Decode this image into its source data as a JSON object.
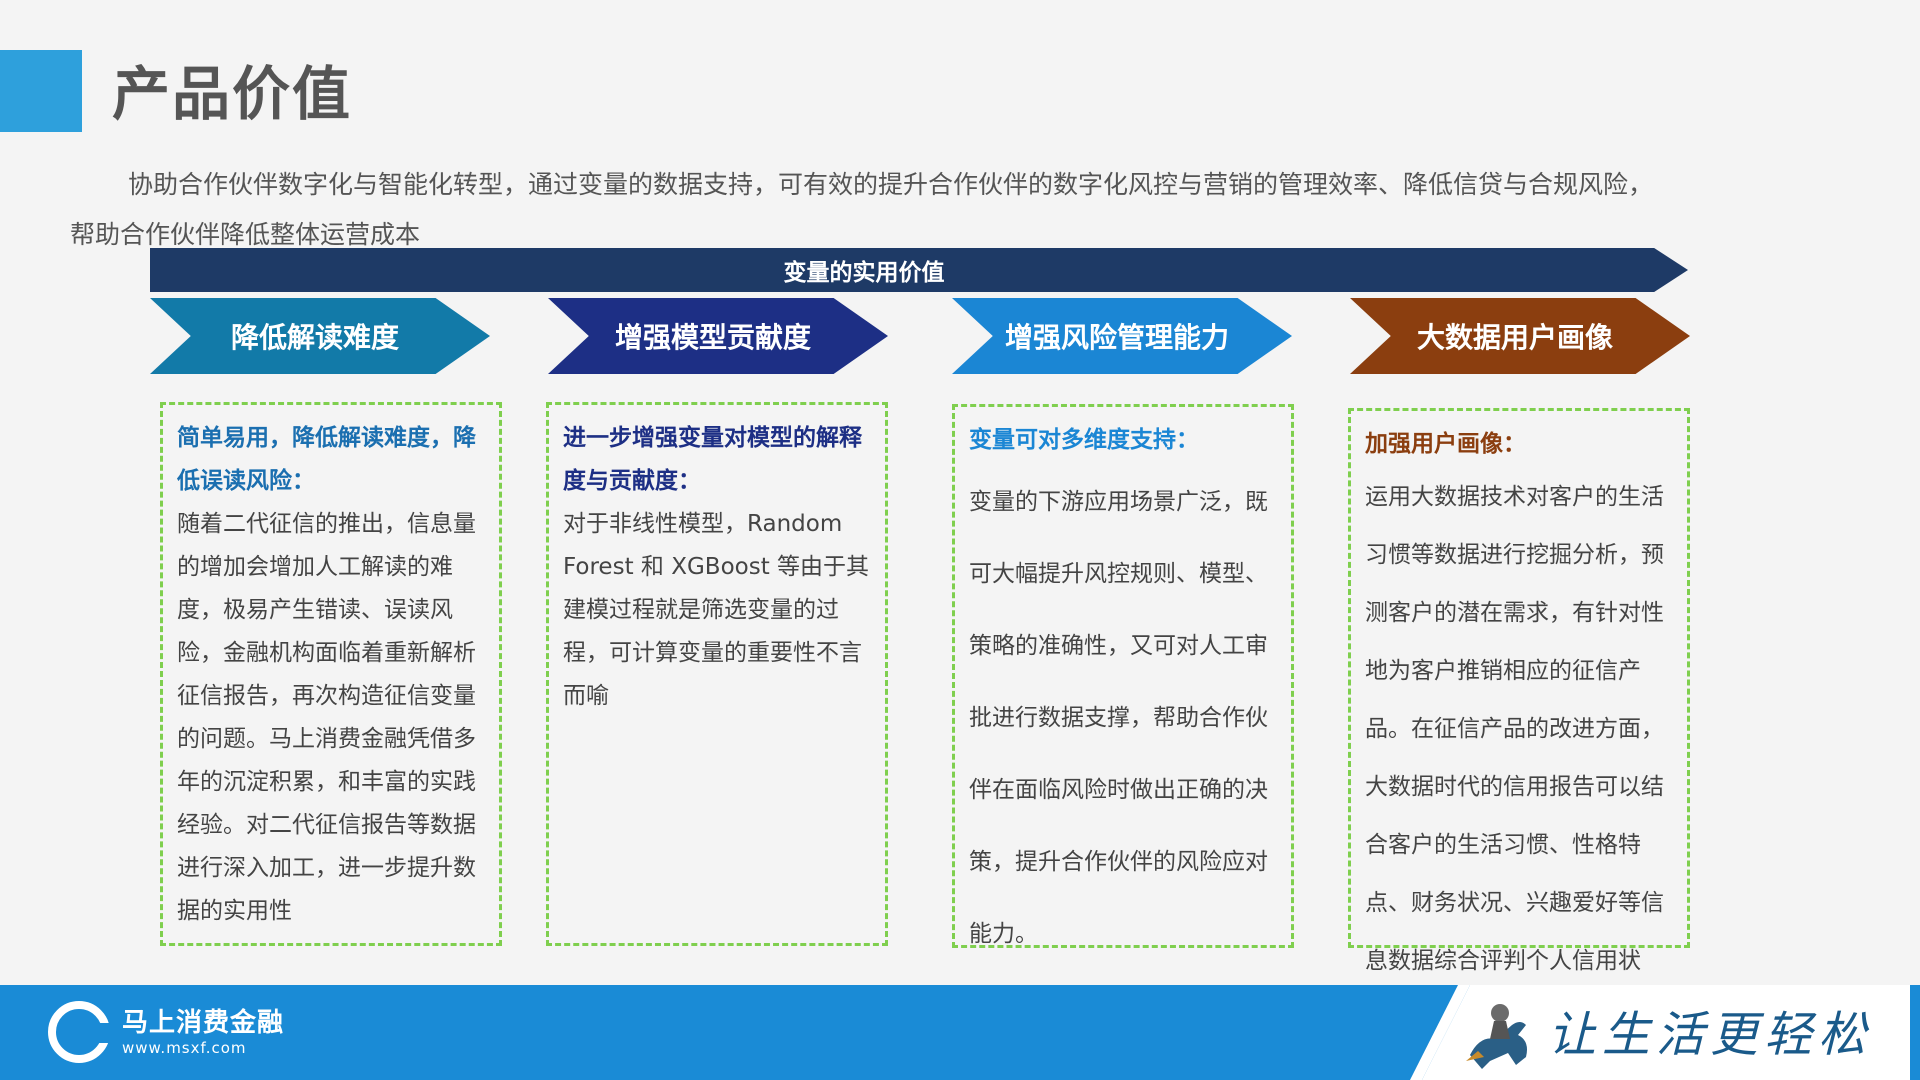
{
  "header": {
    "title": "产品价值"
  },
  "intro": {
    "text": "协助合作伙伴数字化与智能化转型，通过变量的数据支持，可有效的提升合作伙伴的数字化风控与营销的管理效率、降低信贷与合规风险，帮助合作伙伴降低整体运营成本"
  },
  "banner": {
    "label": "变量的实用价值"
  },
  "columns": [
    {
      "label": "降低解读难度",
      "color": "#127aa8",
      "heading": "简单易用，降低解读难度，降低误读风险：",
      "heading_color": "#1b6fb0",
      "body": "随着二代征信的推出，信息量的增加会增加人工解读的难度，极易产生错读、误读风险，金融机构面临着重新解析征信报告，再次构造征信变量的问题。马上消费金融凭借多年的沉淀积累，和丰富的实践经验。对二代征信报告等数据进行深入加工，进一步提升数据的实用性"
    },
    {
      "label": "增强模型贡献度",
      "color": "#1d2f85",
      "heading": "进一步增强变量对模型的解释度与贡献度：",
      "heading_color": "#1d2f85",
      "body": "对于非线性模型，Random Forest 和 XGBoost 等由于其建模过程就是筛选变量的过程，可计算变量的重要性不言而喻"
    },
    {
      "label": "增强风险管理能力",
      "color": "#1b86d4",
      "heading": "变量可对多维度支持：",
      "heading_color": "#1b86d4",
      "body": "变量的下游应用场景广泛，既可大幅提升风控规则、模型、策略的准确性，又可对人工审批进行数据支撑，帮助合作伙伴在面临风险时做出正确的决策，提升合作伙伴的风险应对能力。"
    },
    {
      "label": "大数据用户画像",
      "color": "#8b3e0f",
      "heading": "加强用户画像：",
      "heading_color": "#8b3e0f",
      "body": "运用大数据技术对客户的生活习惯等数据进行挖掘分析，预测客户的潜在需求，有针对性地为客户推销相应的征信产品。在征信产品的改进方面，大数据时代的信用报告可以结合客户的生活习惯、性格特点、财务状况、兴趣爱好等信息数据综合评判个人信用状况。"
    }
  ],
  "footer": {
    "logo_name": "马上消费金融",
    "logo_url": "www.msxf.com",
    "slogan": "让生活更轻松",
    "logo_icon": "msxf-logo-icon",
    "mascot_icon": "rider-mascot-icon"
  },
  "colors": {
    "accent": "#2ea0dc",
    "banner": "#1e3a66",
    "footer": "#1a8bd6",
    "dash_border": "#7fcf4e"
  }
}
